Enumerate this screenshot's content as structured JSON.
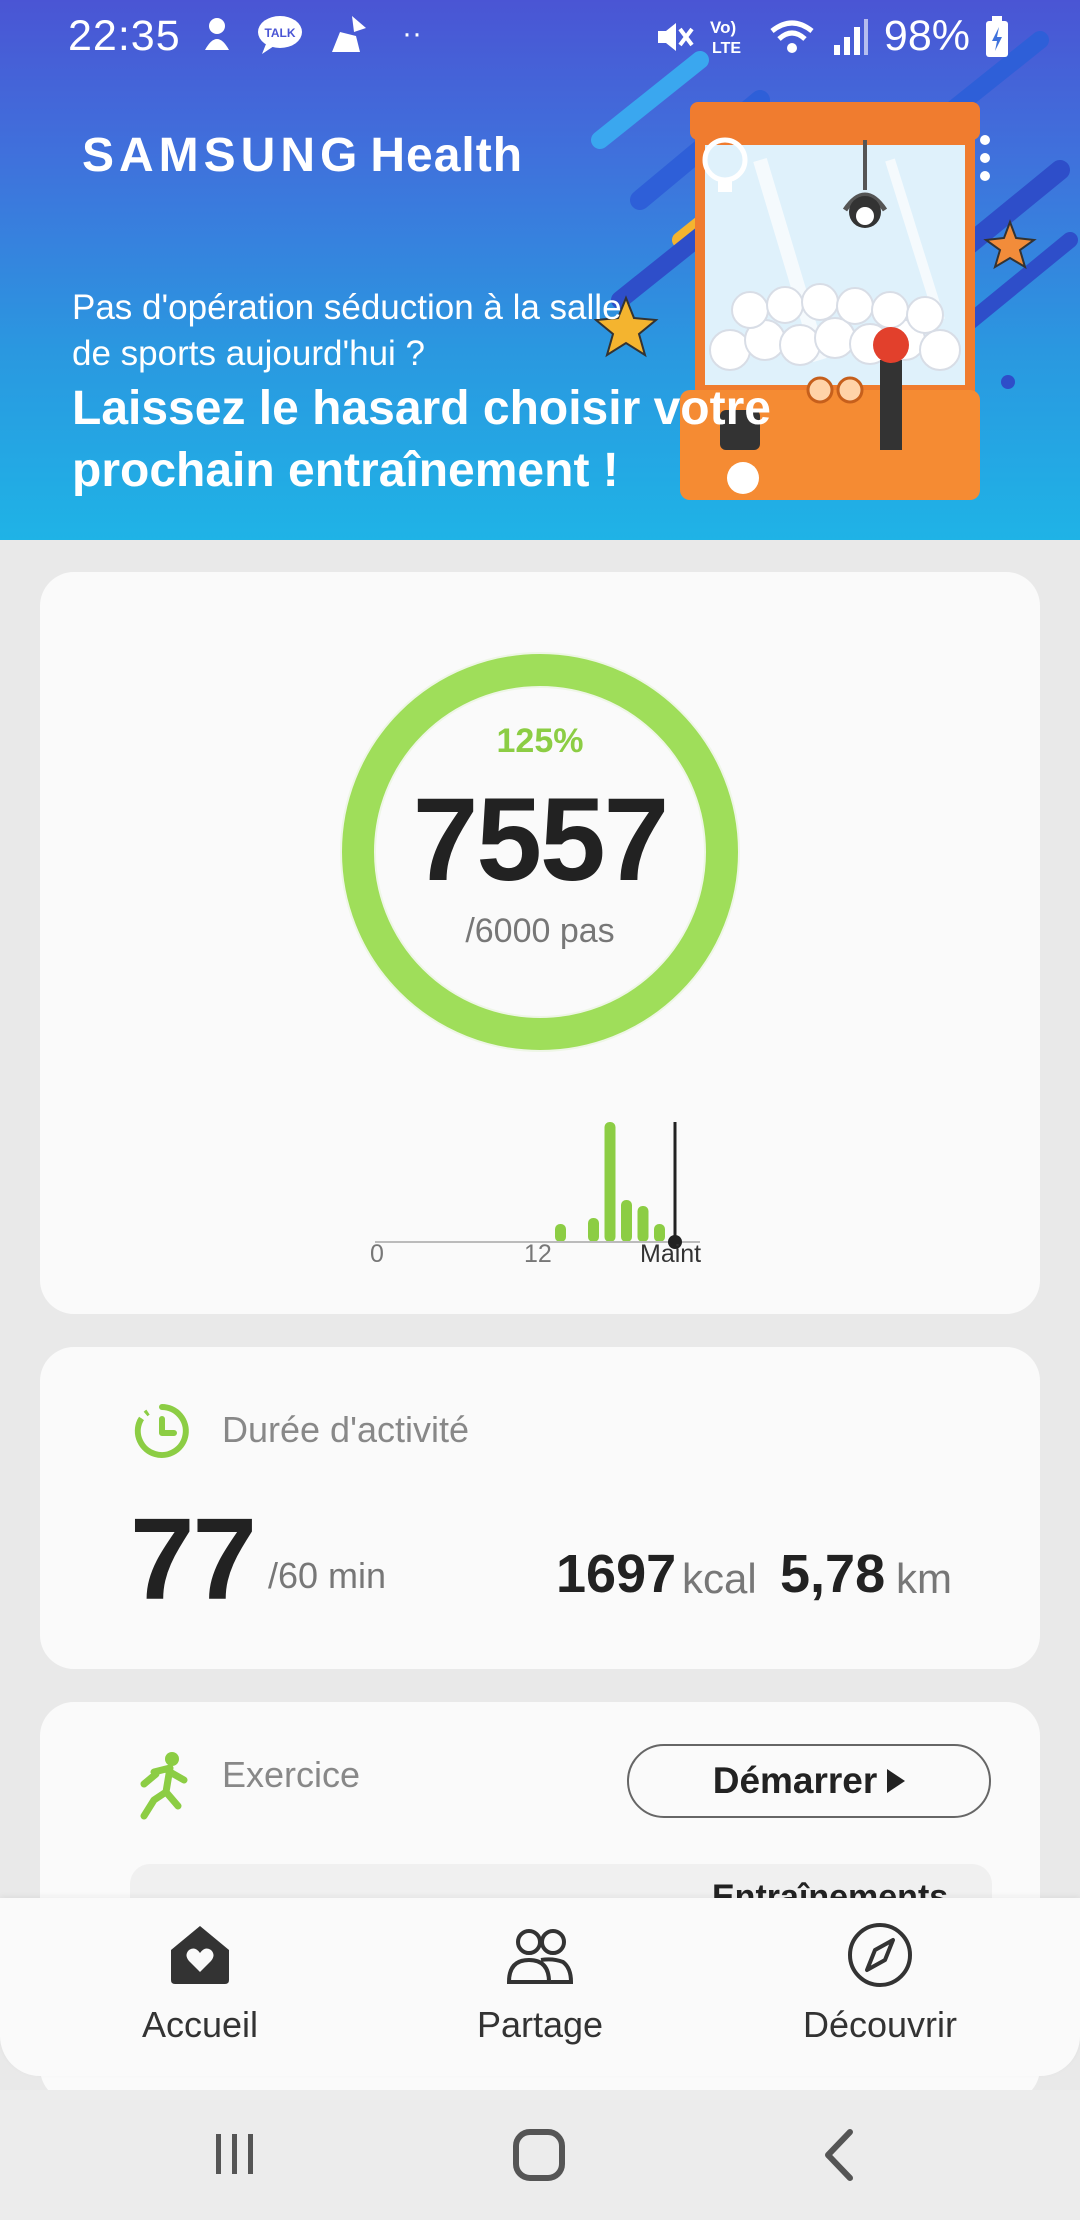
{
  "status_bar": {
    "time": "22:35",
    "battery": "98%",
    "left_icons": [
      "notification-icon",
      "kakaotalk-icon",
      "cleaner-icon"
    ],
    "right_icons": [
      "mute-icon",
      "volte-icon",
      "wifi-icon",
      "signal-icon",
      "battery-charging-icon"
    ],
    "lte_label": "LTE",
    "volte_label": "Vo)",
    "talk_label": "TALK"
  },
  "header": {
    "brand_samsung": "SAMSUNG",
    "brand_health": "Health",
    "banner_sub": "Pas d'opération séduction à la salle de sports aujourd'hui ?",
    "banner_headline": "Laissez le hasard choisir votre prochain entraînement !"
  },
  "steps": {
    "percent": "125%",
    "count": "7557",
    "goal": "/6000 pas",
    "progress_fraction": 1.0,
    "ring_color": "#9fde5a",
    "axis_labels": {
      "start": "0",
      "mid": "12",
      "now": "Maint"
    },
    "hourly_bars": [
      0,
      0,
      0,
      0,
      0,
      0,
      0,
      0,
      0,
      0,
      0.15,
      0,
      0.2,
      1.0,
      0.35,
      0.3,
      0.15,
      0
    ]
  },
  "activity": {
    "title": "Durée d'activité",
    "value": "77",
    "goal": "/60 min",
    "kcal": "1697",
    "kcal_unit": "kcal",
    "km": "5,78",
    "km_unit": "km"
  },
  "exercise": {
    "title": "Exercice",
    "start_label": "Démarrer",
    "inner_label": "Entraînements"
  },
  "nav": {
    "home": "Accueil",
    "share": "Partage",
    "discover": "Découvrir"
  },
  "colors": {
    "accent_green": "#8ccd44",
    "banner_top": "#4a55d4",
    "banner_bottom": "#1fb3e6"
  }
}
